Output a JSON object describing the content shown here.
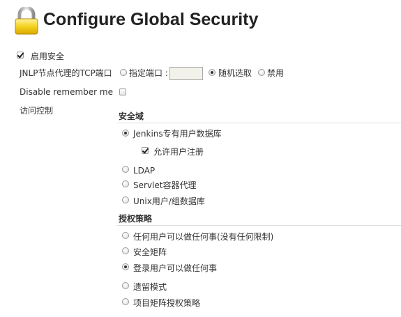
{
  "page": {
    "title": "Configure Global Security"
  },
  "security": {
    "enable_label": "启用安全",
    "enable_checked": true
  },
  "jnlp": {
    "label": "JNLP节点代理的TCP端口",
    "options": [
      "指定端口 :",
      "随机选取",
      "禁用"
    ],
    "selected": "随机选取",
    "port_value": ""
  },
  "remember_me": {
    "label": "Disable remember me",
    "checked": false
  },
  "access_control": {
    "label": "访问控制",
    "realm": {
      "heading": "安全域",
      "options": [
        "Jenkins专有用户数据库",
        "LDAP",
        "Servlet容器代理",
        "Unix用户/组数据库"
      ],
      "selected": "Jenkins专有用户数据库",
      "allow_signup_label": "允许用户注册",
      "allow_signup_checked": true
    },
    "authorization": {
      "heading": "授权策略",
      "options": [
        "任何用户可以做任何事(没有任何限制)",
        "安全矩阵",
        "登录用户可以做任何事",
        "遗留模式",
        "项目矩阵授权策略"
      ],
      "selected": "登录用户可以做任何事"
    }
  }
}
